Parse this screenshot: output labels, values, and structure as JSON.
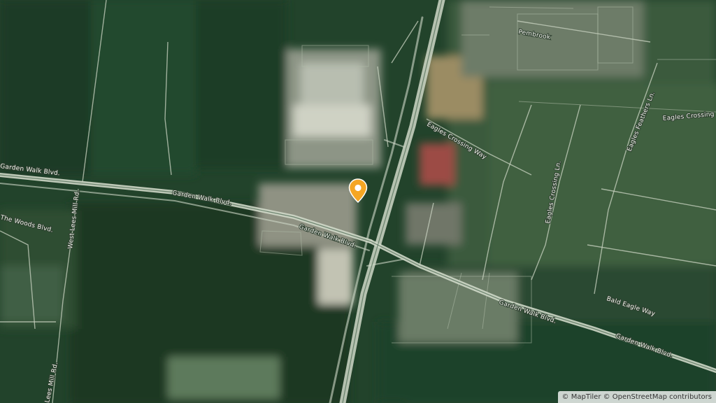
{
  "map": {
    "type": "satellite",
    "marker_color": "#f5a623",
    "labels": {
      "pembrook": "Pembrook",
      "eagles_crossing_way": "Eagles Crossing Way",
      "eagles_feathers_ln": "Eagles Feathers Ln.",
      "eagles_crossing_top": "Eagles Crossing",
      "eagles_crossing_ln": "Eagles Crossing Ln.",
      "garden_walk_left": "Garden Walk Blvd.",
      "garden_walk_center": "Garden Walk Blvd.",
      "garden_walk_mid": "Garden Walk Blvd.",
      "west_lees_mill": "West Lees Mill Rd.",
      "the_woods": "The Woods Blvd.",
      "lees_mill_bottom": "Lees Mill Rd.",
      "bald_eagle_way": "Bald Eagle Way",
      "garden_walk_right": "Garden Walk Blvd.",
      "garden_walk_far_right": "Garden Walk Blvd."
    }
  },
  "attribution": {
    "maptiler": "© MapTiler",
    "osm": "© OpenStreetMap contributors"
  }
}
